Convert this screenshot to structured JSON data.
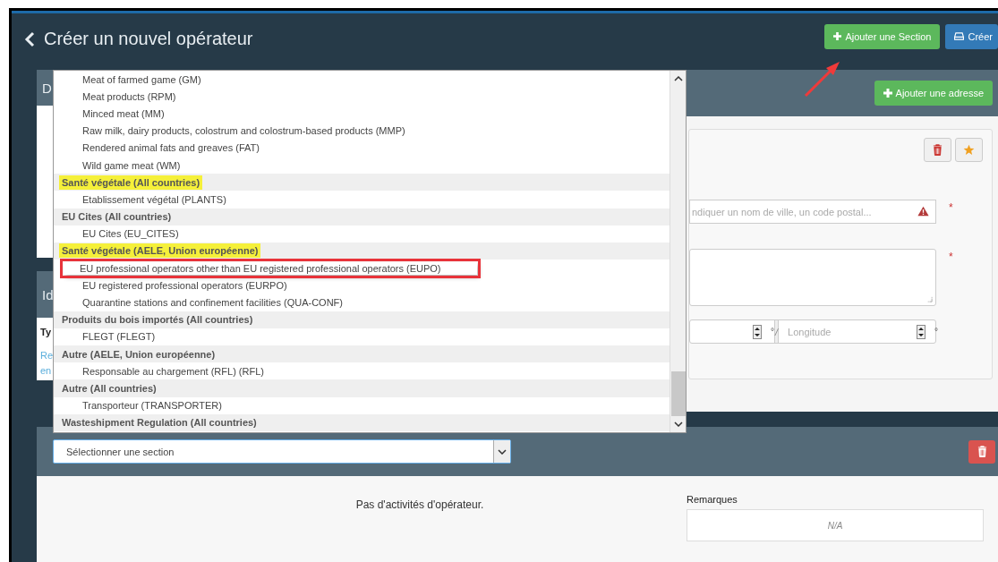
{
  "header": {
    "title": "Créer un nouvel opérateur",
    "buttons": [
      {
        "label": "Ajouter une Section",
        "kind": "add"
      },
      {
        "label": "Créer",
        "kind": "save"
      }
    ]
  },
  "background_panels": {
    "details_heading": "D",
    "identification_heading": "Id",
    "type_label": "Ty",
    "link_lines": [
      "Re",
      "en"
    ]
  },
  "address": {
    "add_button": "Ajouter une adresse",
    "city_placeholder": "ndiquer un nom de ville, un code postal...",
    "longitude_placeholder": "Longitude",
    "degree_signs": [
      "°",
      "°"
    ],
    "separator": "/",
    "required_marks": [
      "*",
      "*"
    ]
  },
  "section_dropdown": {
    "items": [
      {
        "kind": "option",
        "label": "Meat of farmed game (GM)",
        "highlighted": false,
        "boxed": false
      },
      {
        "kind": "option",
        "label": "Meat products (RPM)",
        "highlighted": false,
        "boxed": false
      },
      {
        "kind": "option",
        "label": "Minced meat (MM)",
        "highlighted": false,
        "boxed": false
      },
      {
        "kind": "option",
        "label": "Raw milk, dairy products, colostrum and colostrum-based products (MMP)",
        "highlighted": false,
        "boxed": false
      },
      {
        "kind": "option",
        "label": "Rendered animal fats and greaves (FAT)",
        "highlighted": false,
        "boxed": false
      },
      {
        "kind": "option",
        "label": "Wild game meat (WM)",
        "highlighted": false,
        "boxed": false
      },
      {
        "kind": "group",
        "label": "Santé végétale (All countries)",
        "highlighted": true,
        "boxed": false
      },
      {
        "kind": "option",
        "label": "Etablissement végétal (PLANTS)",
        "highlighted": false,
        "boxed": false
      },
      {
        "kind": "group",
        "label": "EU Cites (All countries)",
        "highlighted": false,
        "boxed": false
      },
      {
        "kind": "option",
        "label": "EU Cites (EU_CITES)",
        "highlighted": false,
        "boxed": false
      },
      {
        "kind": "group",
        "label": "Santé végétale (AELE, Union européenne)",
        "highlighted": true,
        "boxed": false
      },
      {
        "kind": "option",
        "label": "EU professional operators other than EU registered professional operators (EUPO)",
        "highlighted": false,
        "boxed": true
      },
      {
        "kind": "option",
        "label": "EU registered professional operators (EURPO)",
        "highlighted": false,
        "boxed": false
      },
      {
        "kind": "option",
        "label": "Quarantine stations and confinement facilities (QUA-CONF)",
        "highlighted": false,
        "boxed": false
      },
      {
        "kind": "group",
        "label": "Produits du bois importés (All countries)",
        "highlighted": false,
        "boxed": false
      },
      {
        "kind": "option",
        "label": "FLEGT (FLEGT)",
        "highlighted": false,
        "boxed": false
      },
      {
        "kind": "group",
        "label": "Autre (AELE, Union européenne)",
        "highlighted": false,
        "boxed": false
      },
      {
        "kind": "option",
        "label": "Responsable au chargement (RFL) (RFL)",
        "highlighted": false,
        "boxed": false
      },
      {
        "kind": "group",
        "label": "Autre (All countries)",
        "highlighted": false,
        "boxed": false
      },
      {
        "kind": "option",
        "label": "Transporteur (TRANSPORTER)",
        "highlighted": false,
        "boxed": false
      },
      {
        "kind": "group",
        "label": "Wasteshipment Regulation (All countries)",
        "highlighted": false,
        "boxed": false
      }
    ]
  },
  "section": {
    "select_value": "Sélectionner une section",
    "empty_text": "Pas d'activités d'opérateur.",
    "remarks_label": "Remarques",
    "remarks_value": "N/A"
  }
}
